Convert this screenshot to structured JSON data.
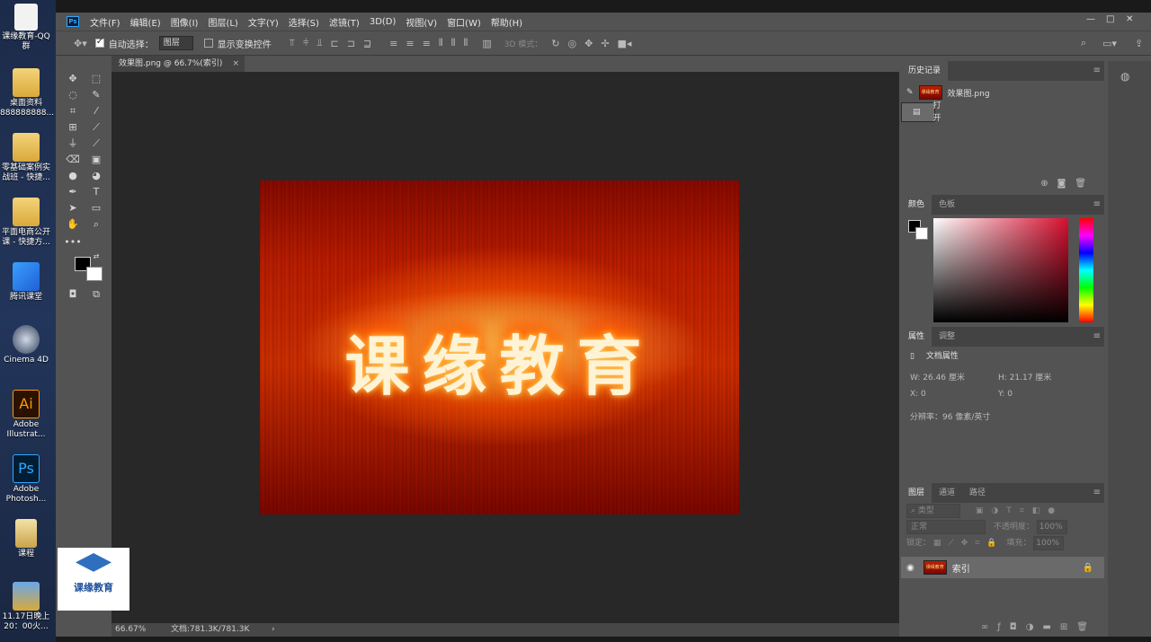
{
  "desktop": {
    "icons": [
      {
        "label": "课缘教育-QQ群"
      },
      {
        "label": "桌面资料888888888..."
      },
      {
        "label": "零基础案例实战班 - 快捷..."
      },
      {
        "label": "平面电商公开课 - 快捷方..."
      },
      {
        "label": "腾讯课堂"
      },
      {
        "label": "Cinema 4D"
      },
      {
        "label": "Adobe Illustrat..."
      },
      {
        "label": "Adobe Photosh..."
      },
      {
        "label": "课程"
      },
      {
        "label": "11.17日晚上 20：00火..."
      }
    ],
    "logo_text": "课缘教育"
  },
  "app": {
    "logo": "Ps",
    "menu": [
      "文件(F)",
      "编辑(E)",
      "图像(I)",
      "图层(L)",
      "文字(Y)",
      "选择(S)",
      "滤镜(T)",
      "3D(D)",
      "视图(V)",
      "窗口(W)",
      "帮助(H)"
    ]
  },
  "options": {
    "auto_select_label": "自动选择：",
    "auto_select_value": "图层",
    "show_transform_label": "显示变换控件",
    "mode_3d_label": "3D 模式："
  },
  "document": {
    "tab_title": "效果图.png @ 66.7%(索引)",
    "art_text": "课缘教育"
  },
  "status": {
    "zoom": "66.67%",
    "doc_size": "文档:781.3K/781.3K"
  },
  "history": {
    "tab": "历史记录",
    "snapshot": "效果图.png",
    "thumb_text": "课缘教育",
    "step": "打开"
  },
  "color": {
    "tab_color": "颜色",
    "tab_swatches": "色板",
    "fg": "#000000",
    "bg": "#ffffff"
  },
  "properties": {
    "tab_props": "属性",
    "tab_adjust": "调整",
    "title": "文档属性",
    "w": "W:  26.46  厘米",
    "h": "H:  21.17  厘米",
    "x": "X:  0",
    "y": "Y:  0",
    "resolution": "分辨率：96 像素/英寸"
  },
  "layers": {
    "tab_layers": "图层",
    "tab_channels": "通道",
    "tab_paths": "路径",
    "filter_placeholder": "类型",
    "blend_mode": "正常",
    "opacity_label": "不透明度：",
    "opacity_value": "100%",
    "lock_label": "锁定：",
    "fill_label": "填充：",
    "fill_value": "100%",
    "layer_name": "索引"
  }
}
